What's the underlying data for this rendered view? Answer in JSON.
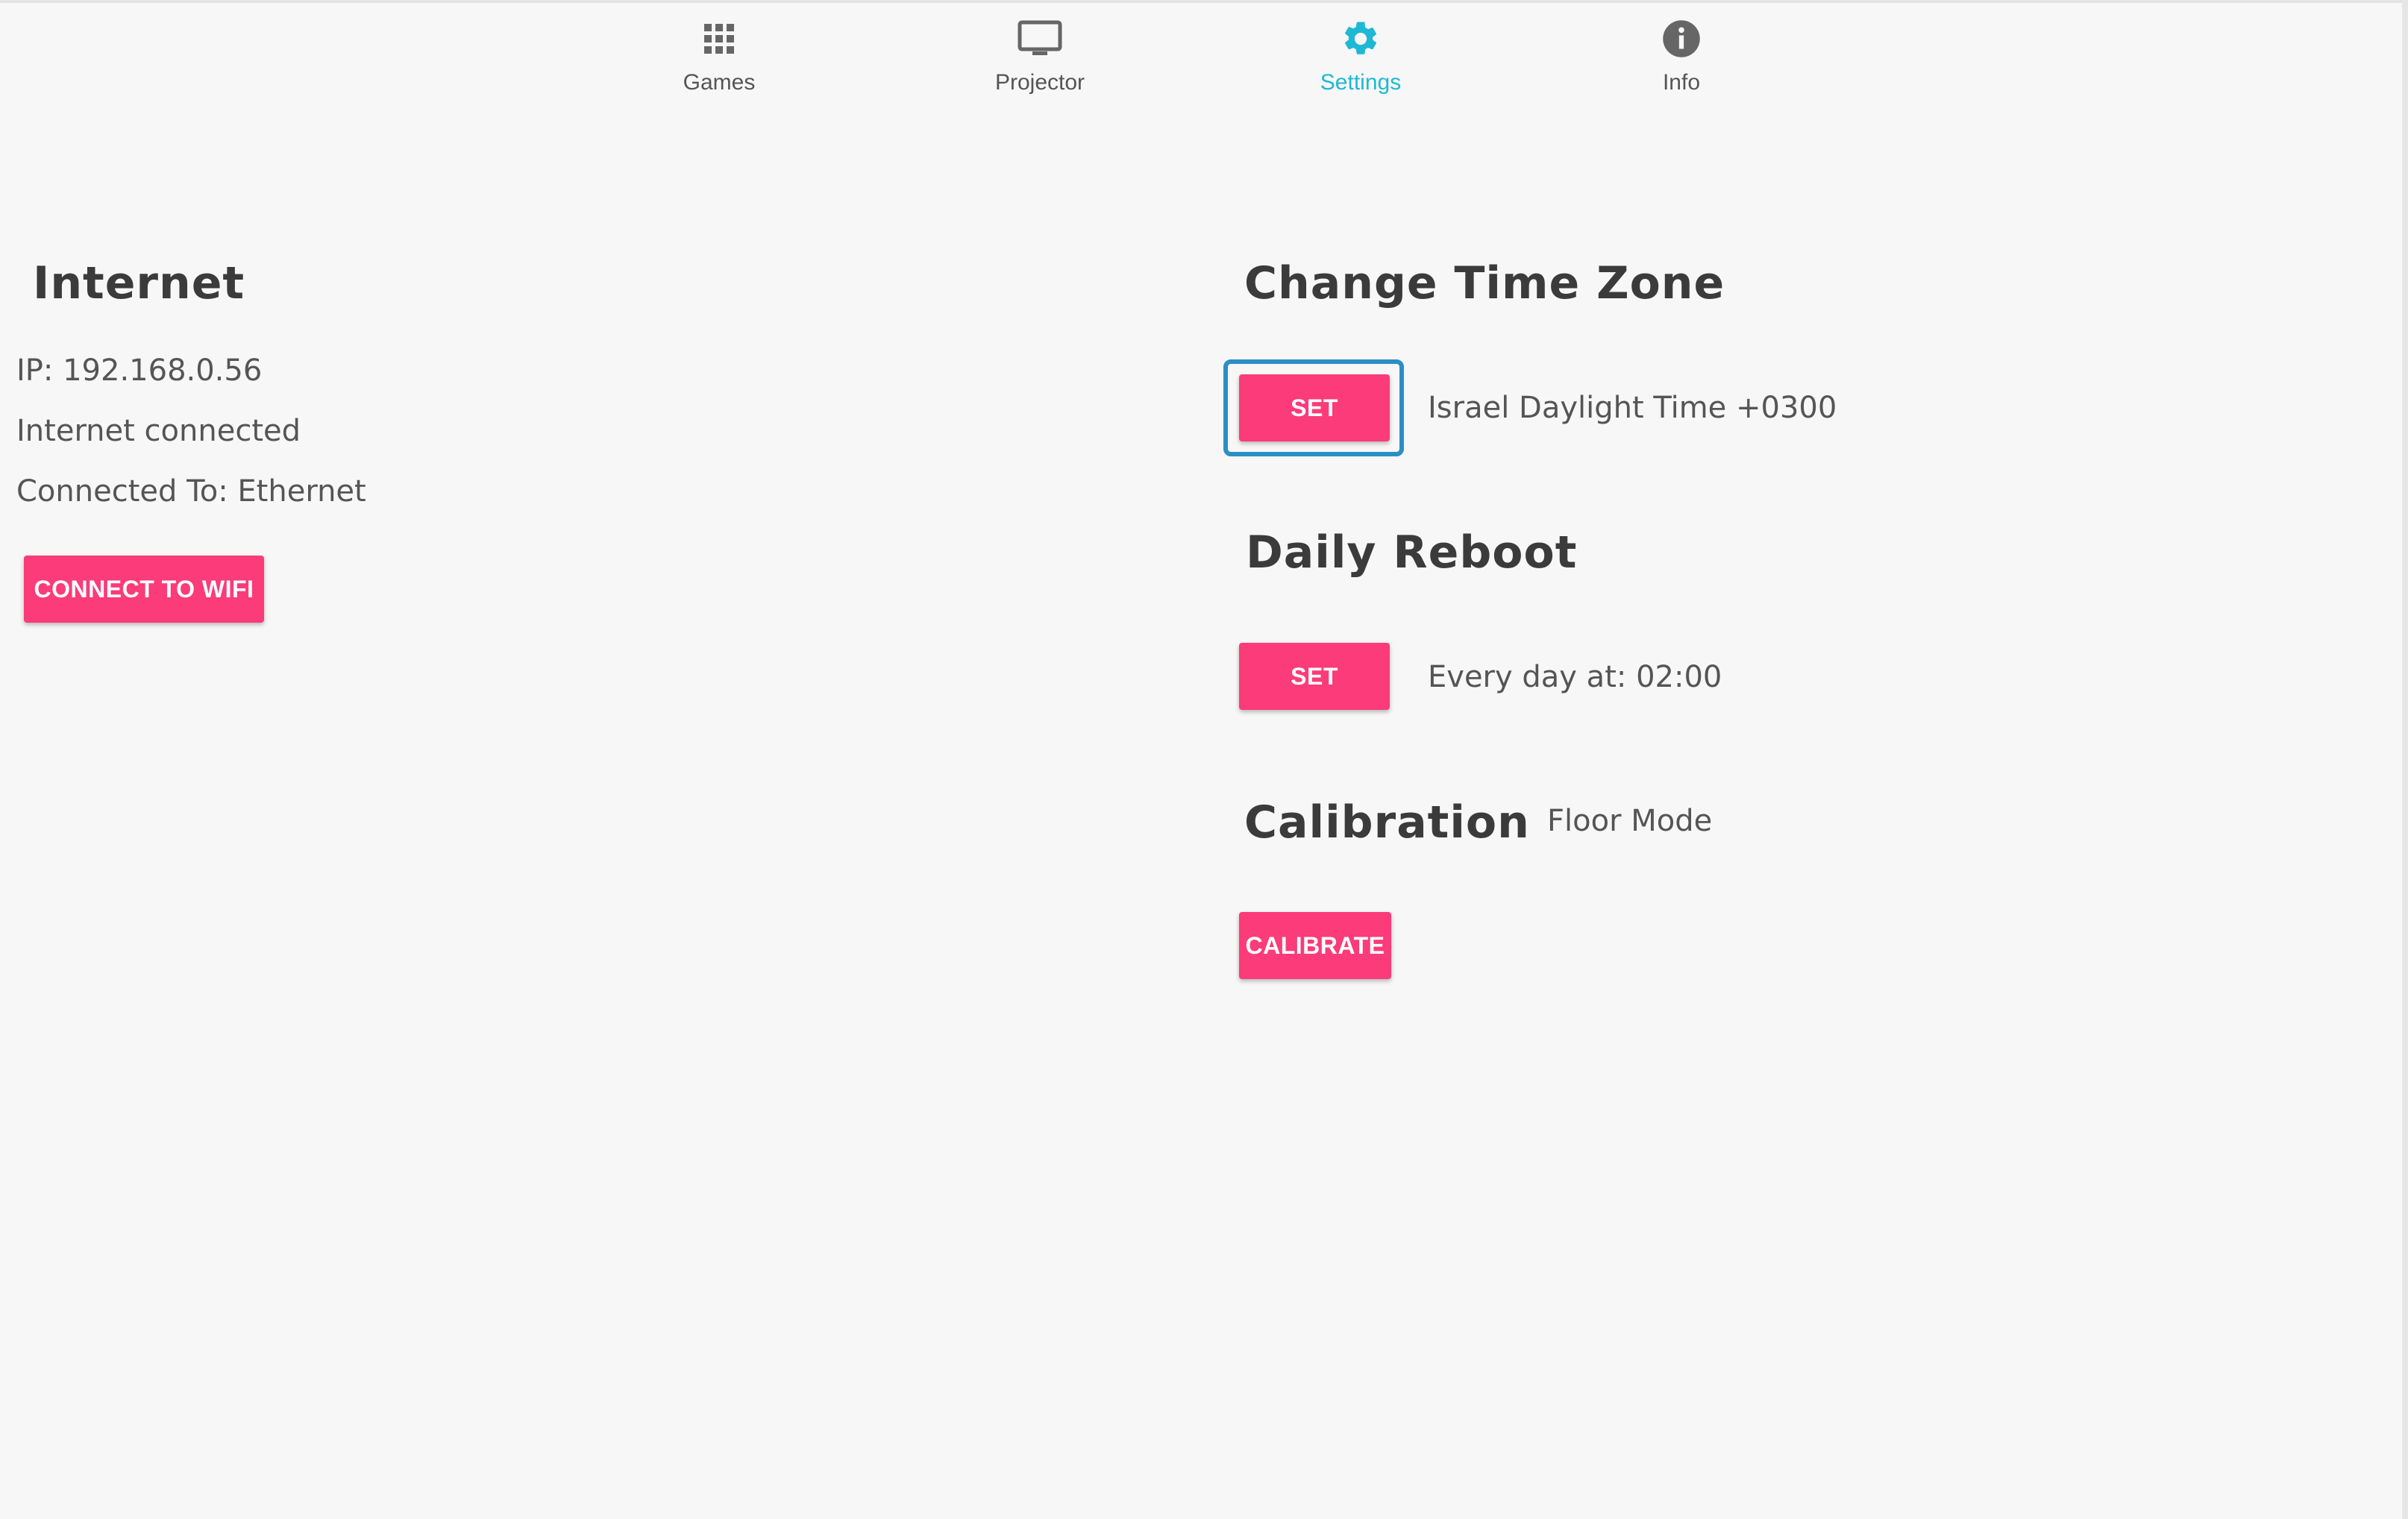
{
  "nav": {
    "tabs": [
      {
        "label": "Games",
        "icon": "grid-icon",
        "active": false
      },
      {
        "label": "Projector",
        "icon": "monitor-icon",
        "active": false
      },
      {
        "label": "Settings",
        "icon": "gear-icon",
        "active": true
      },
      {
        "label": "Info",
        "icon": "info-icon",
        "active": false
      }
    ]
  },
  "internet": {
    "title": "Internet",
    "ip": "IP: 192.168.0.56",
    "status": "Internet connected",
    "connected_to": "Connected To: Ethernet",
    "wifi_button": "CONNECT TO WIFI"
  },
  "timezone": {
    "title": "Change Time Zone",
    "set_button": "SET",
    "value": "Israel Daylight Time +0300"
  },
  "reboot": {
    "title": "Daily Reboot",
    "set_button": "SET",
    "value": "Every day at: 02:00"
  },
  "calibration": {
    "title": "Calibration",
    "mode": "Floor Mode",
    "button": "CALIBRATE"
  },
  "colors": {
    "accent": "#1fb8d4",
    "button": "#fb3b7a",
    "focus": "#2a8fc4",
    "background": "#f7f7f7"
  }
}
